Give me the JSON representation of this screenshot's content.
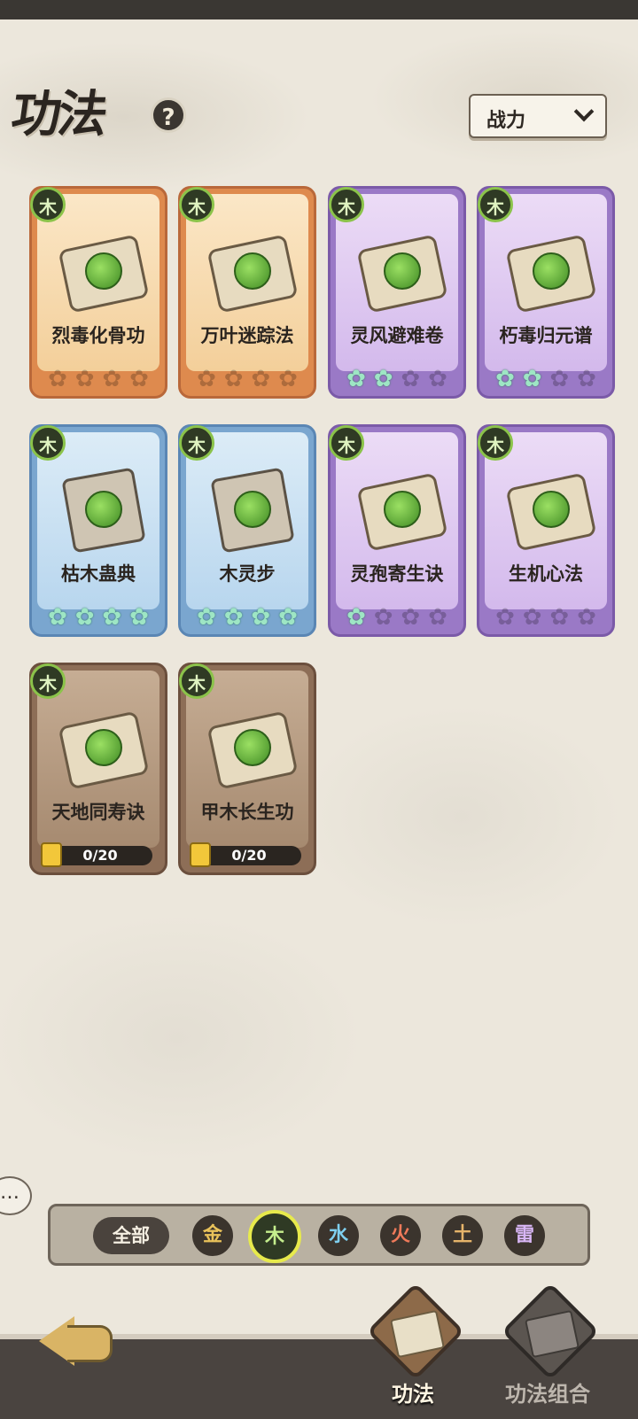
{
  "header": {
    "title": "功法",
    "help_icon": "?",
    "sort_label": "战力"
  },
  "cards": [
    {
      "name": "烈毒化骨功",
      "element": "木",
      "rarity": "orange",
      "art": "dragon-scroll",
      "stars_lit": 0,
      "stars_total": 4
    },
    {
      "name": "万叶迷踪法",
      "element": "木",
      "rarity": "orange",
      "art": "dragon-scroll",
      "stars_lit": 0,
      "stars_total": 4
    },
    {
      "name": "灵风避难卷",
      "element": "木",
      "rarity": "purple",
      "art": "scroll-leaf",
      "stars_lit": 2,
      "stars_total": 4
    },
    {
      "name": "朽毒归元谱",
      "element": "木",
      "rarity": "purple",
      "art": "scroll-skull",
      "stars_lit": 2,
      "stars_total": 4
    },
    {
      "name": "枯木蛊典",
      "element": "木",
      "rarity": "blue",
      "art": "book-skull",
      "stars_lit": 4,
      "stars_total": 4
    },
    {
      "name": "木灵步",
      "element": "木",
      "rarity": "blue",
      "art": "book-leaf",
      "stars_lit": 4,
      "stars_total": 4
    },
    {
      "name": "灵孢寄生诀",
      "element": "木",
      "rarity": "purple",
      "art": "scroll-figure",
      "stars_lit": 1,
      "stars_total": 4
    },
    {
      "name": "生机心法",
      "element": "木",
      "rarity": "purple",
      "art": "scroll-orb",
      "stars_lit": 0,
      "stars_total": 4
    },
    {
      "name": "天地同寿诀",
      "element": "木",
      "rarity": "brown",
      "art": "dragon-scroll",
      "fragments": "0/20"
    },
    {
      "name": "甲木长生功",
      "element": "木",
      "rarity": "brown",
      "art": "dragon-scroll",
      "fragments": "0/20"
    }
  ],
  "filters": {
    "all_label": "全部",
    "elements": [
      {
        "label": "金",
        "color": "#e9c25a"
      },
      {
        "label": "木",
        "color": "#c5ef8d",
        "selected": true
      },
      {
        "label": "水",
        "color": "#7fd0f0"
      },
      {
        "label": "火",
        "color": "#f07a5a"
      },
      {
        "label": "土",
        "color": "#e6b46a"
      },
      {
        "label": "雷",
        "color": "#d8b6f5"
      }
    ]
  },
  "chat_icon": "…",
  "bottom_nav": {
    "tabs": [
      {
        "label": "功法",
        "active": true
      },
      {
        "label": "功法组合",
        "active": false
      }
    ]
  }
}
